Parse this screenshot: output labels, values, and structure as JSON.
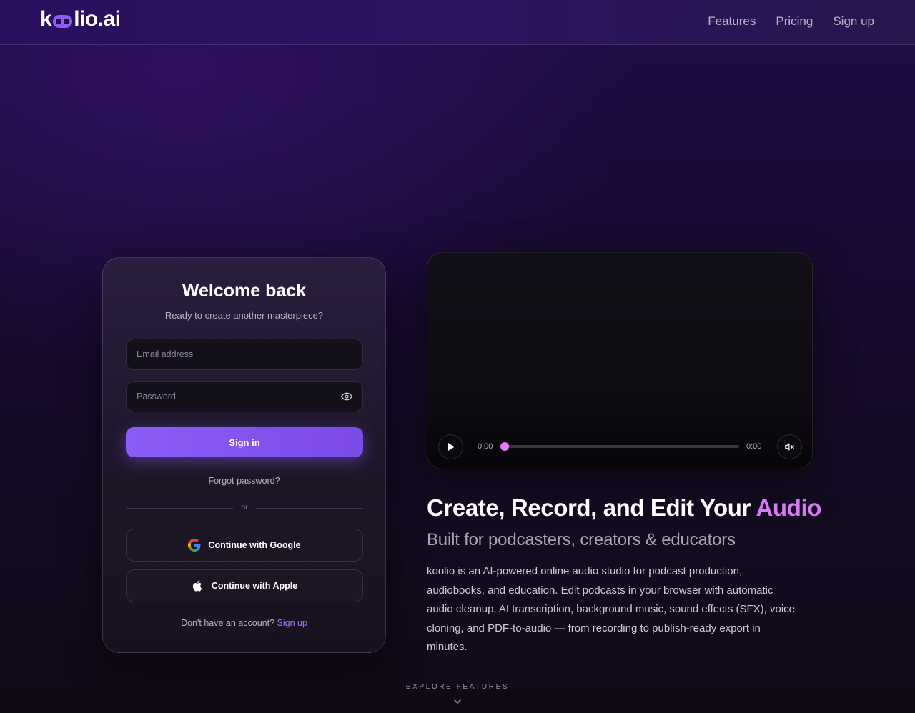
{
  "header": {
    "logo_text": "koolio.ai",
    "nav": [
      {
        "label": "Features"
      },
      {
        "label": "Pricing"
      },
      {
        "label": "Sign up"
      }
    ]
  },
  "login": {
    "title": "Welcome back",
    "subtitle": "Ready to create another masterpiece?",
    "email_placeholder": "Email address",
    "email_value": "",
    "password_placeholder": "Password",
    "password_value": "",
    "signin_label": "Sign in",
    "forgot_label": "Forgot password?",
    "divider_text": "or",
    "google_label": "Continue with Google",
    "apple_label": "Continue with Apple",
    "no_account_text": "Don't have an account?",
    "signup_link": "Sign up"
  },
  "video": {
    "current_time": "0:00",
    "duration": "0:00",
    "progress": 0,
    "muted": true
  },
  "hero": {
    "title_prefix": "Create, Record, and Edit Your ",
    "title_accent": "Audio",
    "subtitle": "Built for podcasters, creators & educators",
    "description": "koolio is an AI-powered online audio studio for podcast production, audiobooks, and education. Edit podcasts in your browser with automatic audio cleanup, AI transcription, background music, sound effects (SFX), voice cloning, and PDF-to-audio — from recording to publish-ready export in minutes."
  },
  "explore": {
    "label": "EXPLORE FEATURES"
  },
  "colors": {
    "accent": "#8b5cf6",
    "accent_pink": "#d77bf5",
    "link": "#a873f7",
    "progress": "#e879f9"
  },
  "icons": [
    "eye-icon",
    "google-icon",
    "apple-icon",
    "play-icon",
    "mute-icon",
    "chevron-down-icon"
  ]
}
